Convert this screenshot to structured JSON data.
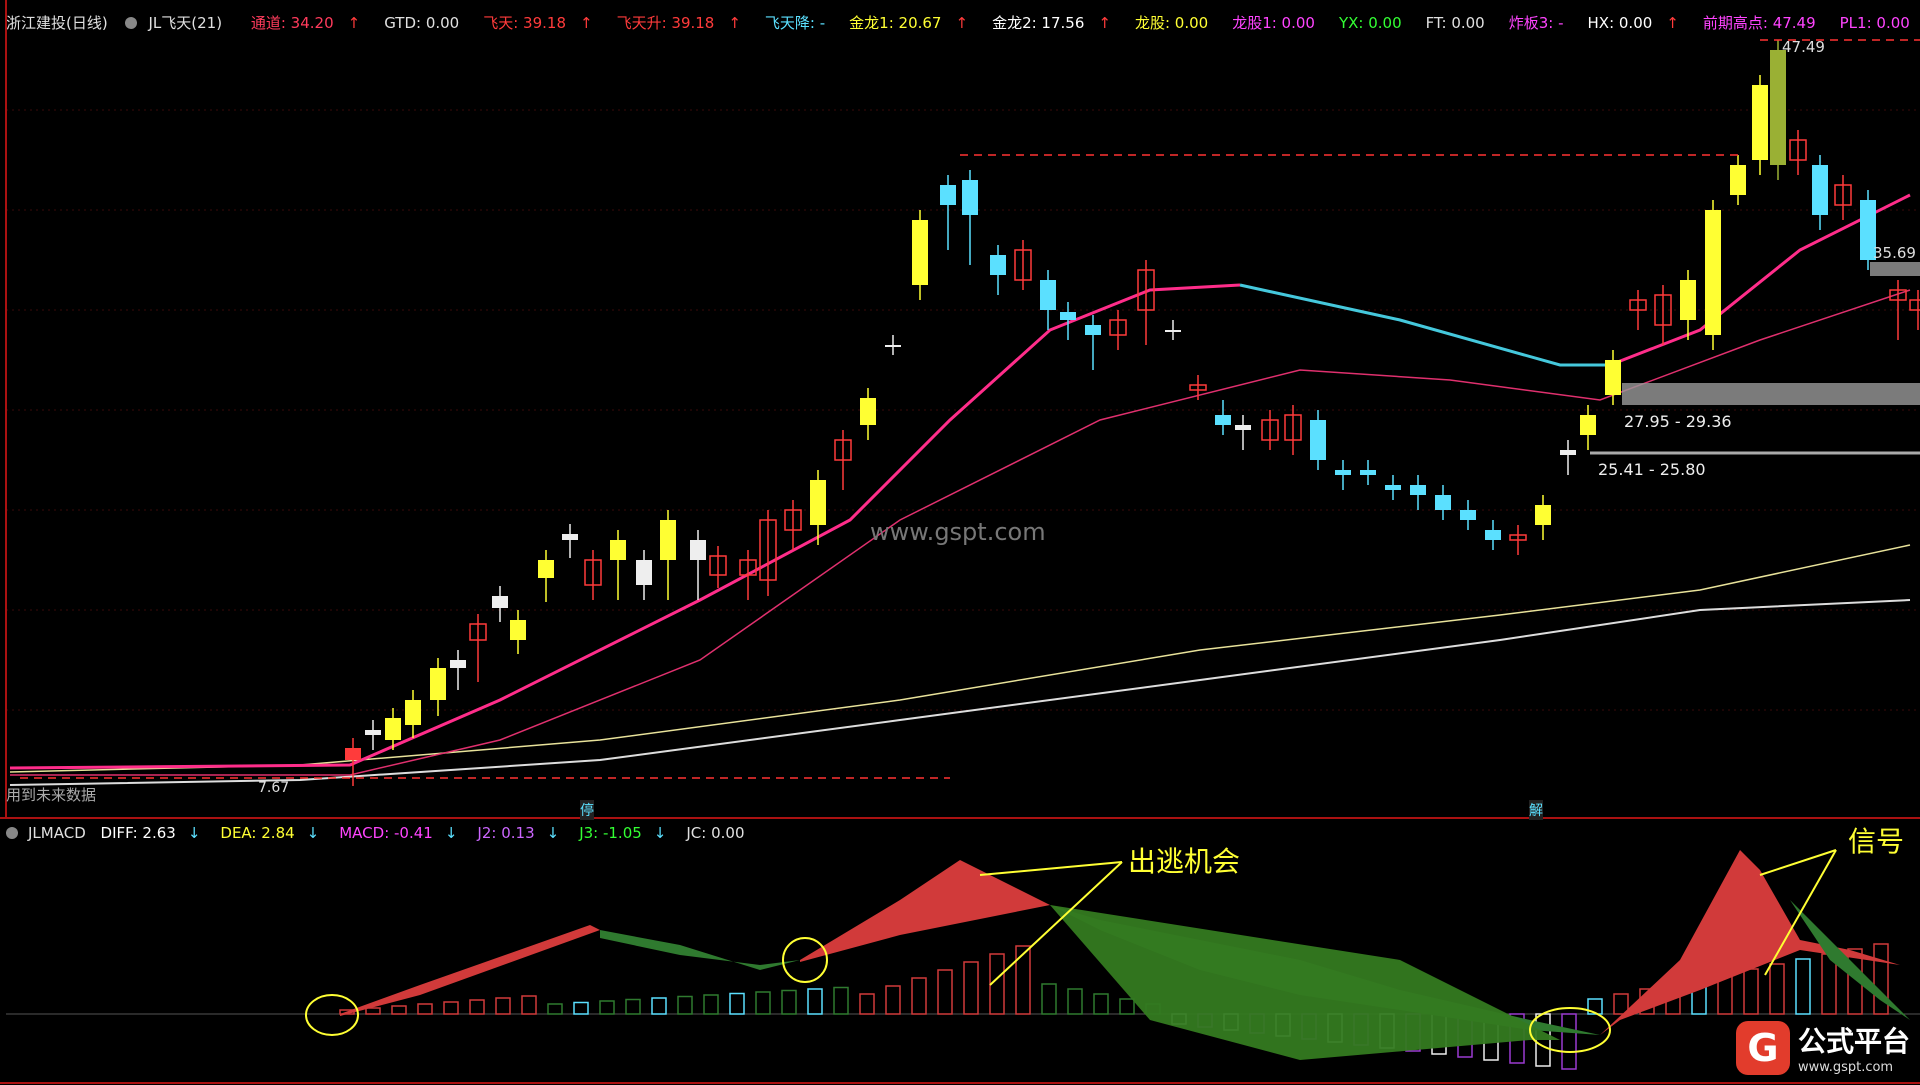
{
  "header": {
    "stock": "浙江建投(日线)",
    "indicator": "JL飞天(21)",
    "fields": [
      {
        "label": "通道: 34.20",
        "color": "#ff3b5c",
        "arrow": "↑"
      },
      {
        "label": "GTD: 0.00",
        "color": "#e0e0e0",
        "arrow": ""
      },
      {
        "label": "飞天: 39.18",
        "color": "#ff3b3b",
        "arrow": "↑"
      },
      {
        "label": "飞天升: 39.18",
        "color": "#ff3b3b",
        "arrow": "↑"
      },
      {
        "label": "飞天降: -",
        "color": "#5be0ff",
        "arrow": ""
      },
      {
        "label": "金龙1: 20.67",
        "color": "#ffff33",
        "arrow": "↑"
      },
      {
        "label": "金龙2: 17.56",
        "color": "#ffffff",
        "arrow": "↑"
      },
      {
        "label": "龙股: 0.00",
        "color": "#ffff33",
        "arrow": ""
      },
      {
        "label": "龙股1: 0.00",
        "color": "#ff44ff",
        "arrow": ""
      },
      {
        "label": "YX: 0.00",
        "color": "#33ff33",
        "arrow": ""
      },
      {
        "label": "FT: 0.00",
        "color": "#e0e0e0",
        "arrow": ""
      },
      {
        "label": "炸板3: -",
        "color": "#ff44ff",
        "arrow": ""
      },
      {
        "label": "HX: 0.00",
        "color": "#ffffff",
        "arrow": "↑"
      },
      {
        "label": "前期高点: 47.49",
        "color": "#ff44ff",
        "arrow": ""
      },
      {
        "label": "PL1: 0.00",
        "color": "#ff44ff",
        "arrow": ""
      }
    ]
  },
  "main": {
    "watermark": "www.gspt.com",
    "price_high": "47.49",
    "price_right": "35.69",
    "zone_upper": "27.95 - 29.36",
    "zone_lower": "25.41 - 25.80",
    "price_low": "7.67",
    "future_data_note": "用到未来数据",
    "marker_stop": "停",
    "marker_release": "解"
  },
  "sub": {
    "name": "JLMACD",
    "fields": [
      {
        "label": "DIFF: 2.63",
        "color": "#ffffff",
        "arrow": "↓"
      },
      {
        "label": "DEA: 2.84",
        "color": "#ffff33",
        "arrow": "↓"
      },
      {
        "label": "MACD: -0.41",
        "color": "#ff44ff",
        "arrow": "↓"
      },
      {
        "label": "J2: 0.13",
        "color": "#cc66ff",
        "arrow": "↓"
      },
      {
        "label": "J3: -1.05",
        "color": "#33ff33",
        "arrow": "↓"
      },
      {
        "label": "JC: 0.00",
        "color": "#e0e0e0",
        "arrow": ""
      }
    ],
    "annotation_escape": "出逃机会",
    "annotation_signal": "信号"
  },
  "logo": {
    "mark": "G",
    "title": "公式平台",
    "url": "www.gspt.com"
  },
  "colors": {
    "up": "#ff3b3b",
    "down": "#5be0ff",
    "yellow": "#ffff33",
    "pink_ma": "#ff2d8a",
    "annotation": "#ffff33"
  }
}
